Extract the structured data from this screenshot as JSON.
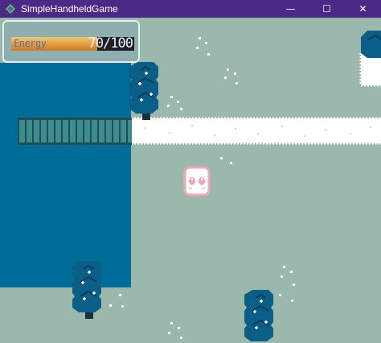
{
  "window": {
    "title": "SimpleHandheldGame",
    "controls": {
      "minimize": "—",
      "maximize": "☐",
      "close": "✕"
    }
  },
  "hud": {
    "energy_label": "Energy",
    "energy_text": "70/100",
    "energy_current": 70,
    "energy_max": 100
  },
  "colors": {
    "ground": "#9ab8ac",
    "water": "#006d99",
    "tree": "#0b5e86",
    "snow": "#ffffff",
    "titlebar": "#4b2a86",
    "energy_fill": "#e39a3c"
  },
  "entities": {
    "player": "pink-creature",
    "trees": 4,
    "bridge": "wooden-bridge"
  }
}
